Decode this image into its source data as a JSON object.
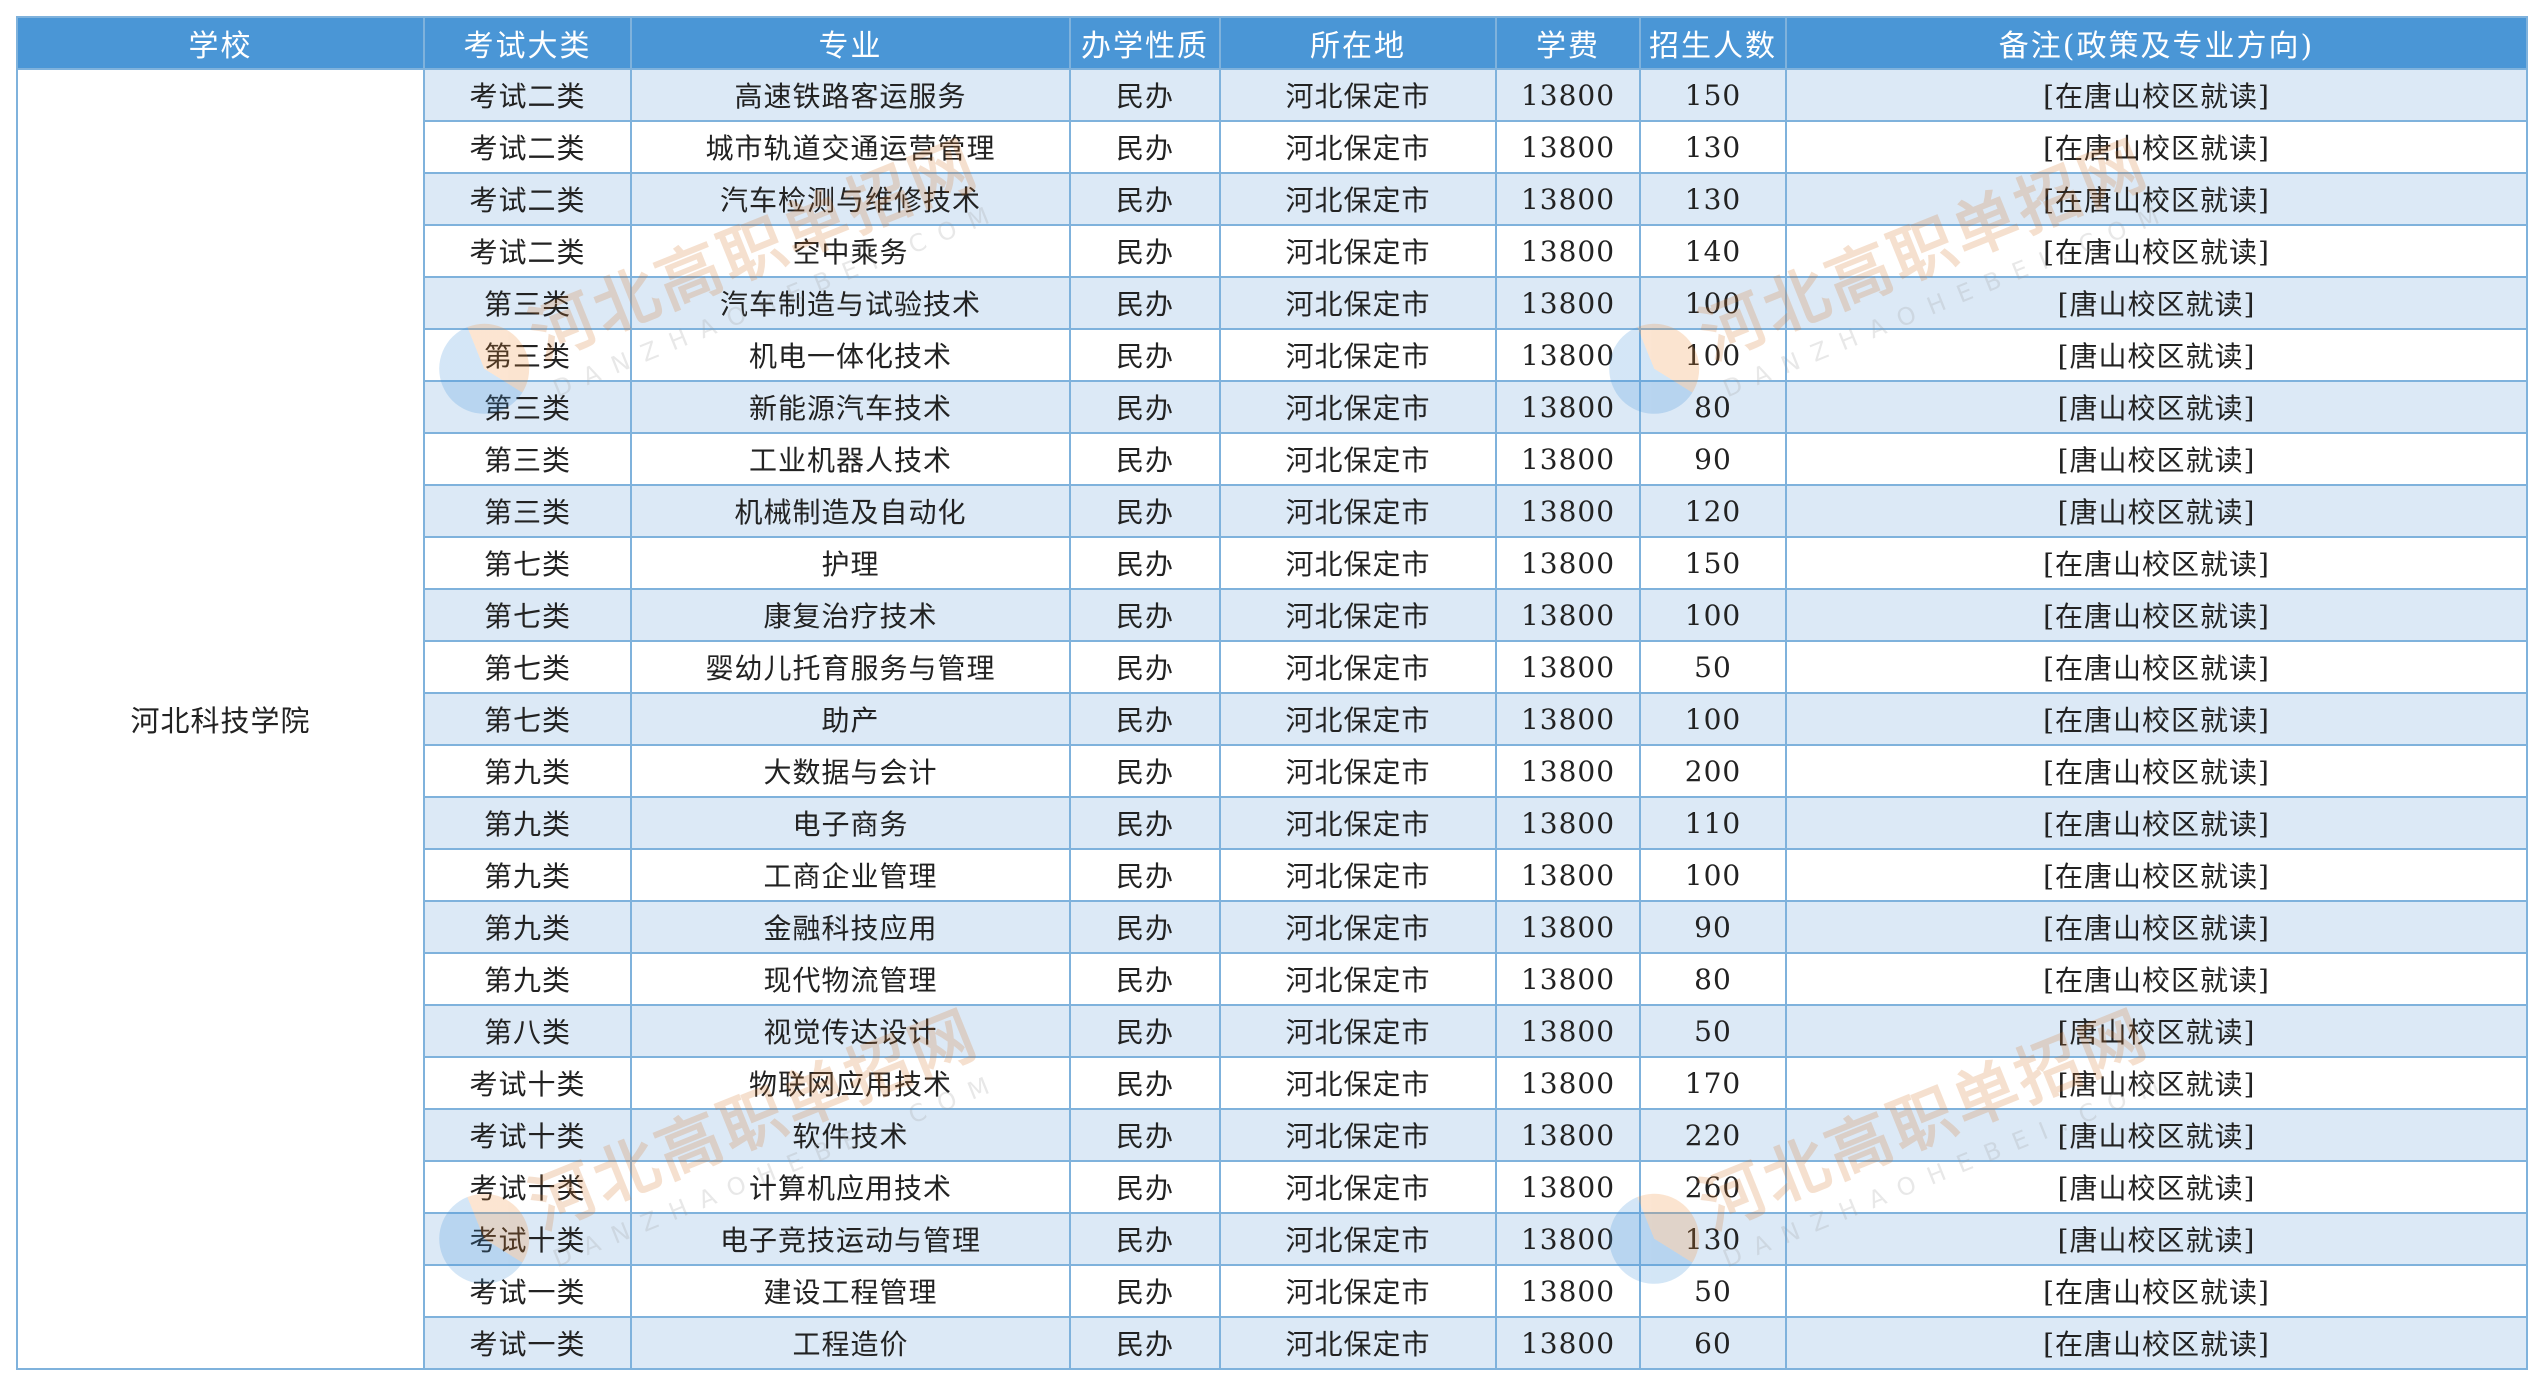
{
  "headers": [
    "学校",
    "考试大类",
    "专业",
    "办学性质",
    "所在地",
    "学费",
    "招生人数",
    "备注(政策及专业方向)"
  ],
  "school": "河北科技学院",
  "rows": [
    [
      "考试二类",
      "高速铁路客运服务",
      "民办",
      "河北保定市",
      "13800",
      "150",
      "[在唐山校区就读]"
    ],
    [
      "考试二类",
      "城市轨道交通运营管理",
      "民办",
      "河北保定市",
      "13800",
      "130",
      "[在唐山校区就读]"
    ],
    [
      "考试二类",
      "汽车检测与维修技术",
      "民办",
      "河北保定市",
      "13800",
      "130",
      "[在唐山校区就读]"
    ],
    [
      "考试二类",
      "空中乘务",
      "民办",
      "河北保定市",
      "13800",
      "140",
      "[在唐山校区就读]"
    ],
    [
      "第三类",
      "汽车制造与试验技术",
      "民办",
      "河北保定市",
      "13800",
      "100",
      "[唐山校区就读]"
    ],
    [
      "第三类",
      "机电一体化技术",
      "民办",
      "河北保定市",
      "13800",
      "100",
      "[唐山校区就读]"
    ],
    [
      "第三类",
      "新能源汽车技术",
      "民办",
      "河北保定市",
      "13800",
      "80",
      "[唐山校区就读]"
    ],
    [
      "第三类",
      "工业机器人技术",
      "民办",
      "河北保定市",
      "13800",
      "90",
      "[唐山校区就读]"
    ],
    [
      "第三类",
      "机械制造及自动化",
      "民办",
      "河北保定市",
      "13800",
      "120",
      "[唐山校区就读]"
    ],
    [
      "第七类",
      "护理",
      "民办",
      "河北保定市",
      "13800",
      "150",
      "[在唐山校区就读]"
    ],
    [
      "第七类",
      "康复治疗技术",
      "民办",
      "河北保定市",
      "13800",
      "100",
      "[在唐山校区就读]"
    ],
    [
      "第七类",
      "婴幼儿托育服务与管理",
      "民办",
      "河北保定市",
      "13800",
      "50",
      "[在唐山校区就读]"
    ],
    [
      "第七类",
      "助产",
      "民办",
      "河北保定市",
      "13800",
      "100",
      "[在唐山校区就读]"
    ],
    [
      "第九类",
      "大数据与会计",
      "民办",
      "河北保定市",
      "13800",
      "200",
      "[在唐山校区就读]"
    ],
    [
      "第九类",
      "电子商务",
      "民办",
      "河北保定市",
      "13800",
      "110",
      "[在唐山校区就读]"
    ],
    [
      "第九类",
      "工商企业管理",
      "民办",
      "河北保定市",
      "13800",
      "100",
      "[在唐山校区就读]"
    ],
    [
      "第九类",
      "金融科技应用",
      "民办",
      "河北保定市",
      "13800",
      "90",
      "[在唐山校区就读]"
    ],
    [
      "第九类",
      "现代物流管理",
      "民办",
      "河北保定市",
      "13800",
      "80",
      "[在唐山校区就读]"
    ],
    [
      "第八类",
      "视觉传达设计",
      "民办",
      "河北保定市",
      "13800",
      "50",
      "[唐山校区就读]"
    ],
    [
      "考试十类",
      "物联网应用技术",
      "民办",
      "河北保定市",
      "13800",
      "170",
      "[唐山校区就读]"
    ],
    [
      "考试十类",
      "软件技术",
      "民办",
      "河北保定市",
      "13800",
      "220",
      "[唐山校区就读]"
    ],
    [
      "考试十类",
      "计算机应用技术",
      "民办",
      "河北保定市",
      "13800",
      "260",
      "[唐山校区就读]"
    ],
    [
      "考试十类",
      "电子竞技运动与管理",
      "民办",
      "河北保定市",
      "13800",
      "130",
      "[唐山校区就读]"
    ],
    [
      "考试一类",
      "建设工程管理",
      "民办",
      "河北保定市",
      "13800",
      "50",
      "[在唐山校区就读]"
    ],
    [
      "考试一类",
      "工程造价",
      "民办",
      "河北保定市",
      "13800",
      "60",
      "[在唐山校区就读]"
    ]
  ],
  "watermark": {
    "cn": "河北高职单招网",
    "en": "DANZHAOHEBEI.COM"
  }
}
